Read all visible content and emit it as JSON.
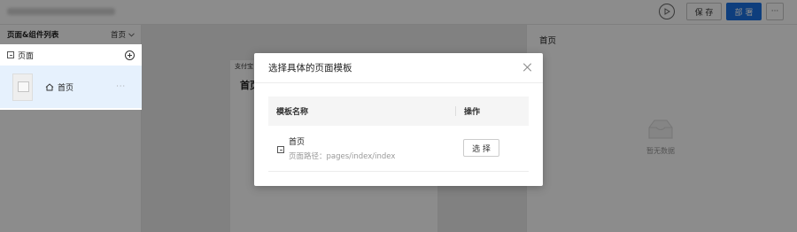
{
  "topbar": {
    "save_label": "保 存",
    "deploy_label": "部 署",
    "more_label": "···"
  },
  "left_panel": {
    "title": "页面&组件列表",
    "selector_value": "首页",
    "section_label": "页面",
    "item_label": "首页",
    "item_more": "···"
  },
  "canvas": {
    "status_text": "支付宝",
    "page_title": "首页"
  },
  "right_panel": {
    "title": "首页",
    "empty_text": "暂无数据"
  },
  "modal": {
    "title": "选择具体的页面模板",
    "col_name": "模板名称",
    "col_action": "操作",
    "rows": [
      {
        "name": "首页",
        "path_label": "页面路径：",
        "path": "pages/index/index",
        "action": "选 择"
      }
    ]
  },
  "colors": {
    "accent": "#1b72e3",
    "selected_bg": "#e6f1fd",
    "overlay": "rgba(0,0,0,0.45)"
  }
}
